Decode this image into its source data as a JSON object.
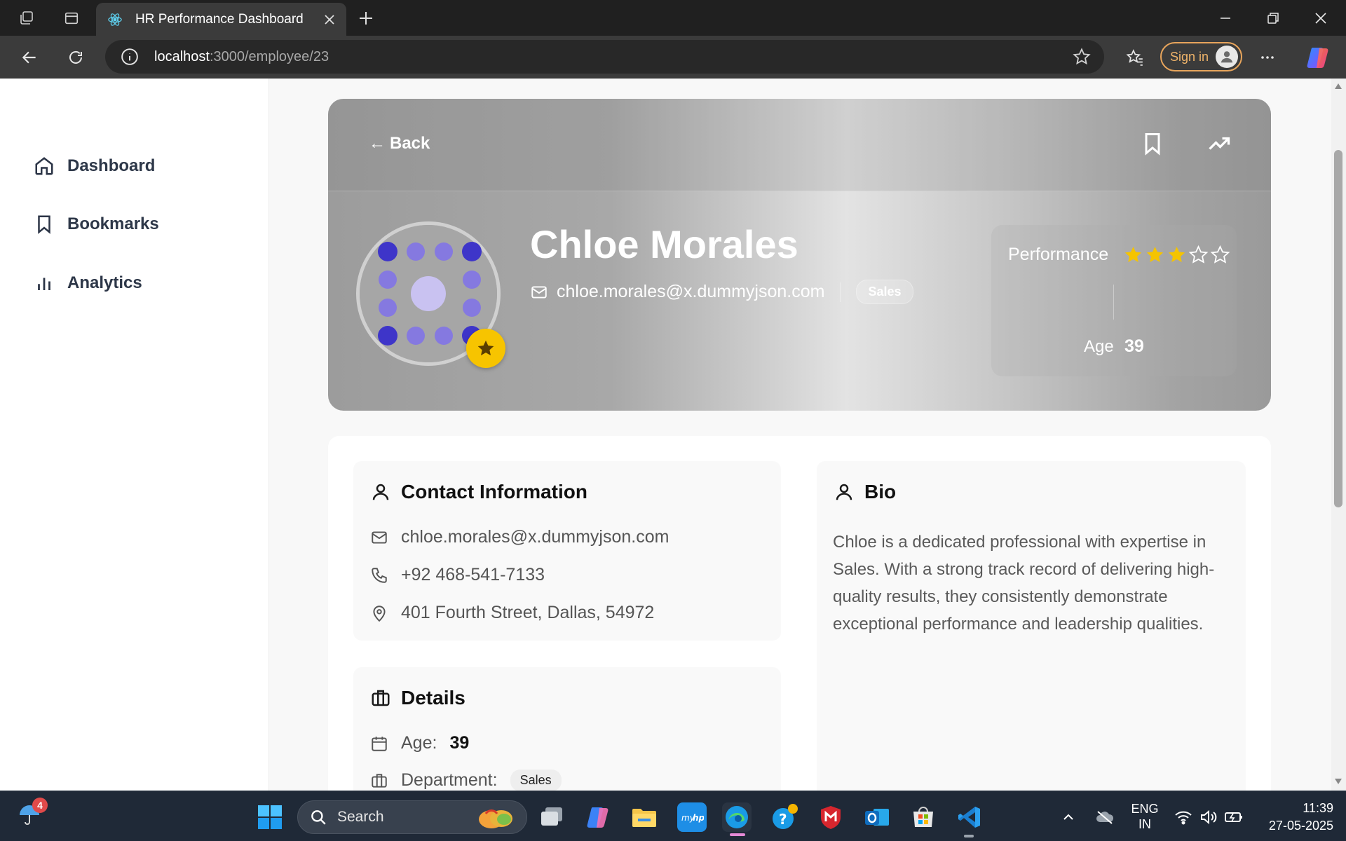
{
  "browser": {
    "tab_title": "HR Performance Dashboard",
    "url_host": "localhost",
    "url_path": ":3000/employee/23",
    "sign_in_label": "Sign in"
  },
  "sidebar": {
    "items": [
      {
        "label": "Dashboard",
        "icon": "home-icon"
      },
      {
        "label": "Bookmarks",
        "icon": "bookmark-icon"
      },
      {
        "label": "Analytics",
        "icon": "bar-chart-icon"
      }
    ]
  },
  "hero": {
    "back_label": "Back",
    "back_arrow": "←",
    "name": "Chloe Morales",
    "email": "chloe.morales@x.dummyjson.com",
    "department": "Sales",
    "performance_label": "Performance",
    "rating": 3,
    "rating_max": 5,
    "age_label": "Age",
    "age_value": "39"
  },
  "contact": {
    "title": "Contact Information",
    "email": "chloe.morales@x.dummyjson.com",
    "phone": "+92 468-541-7133",
    "address": "401 Fourth Street, Dallas, 54972"
  },
  "bio": {
    "title": "Bio",
    "text": "Chloe is a dedicated professional with expertise in Sales. With a strong track record of delivering high-quality results, they consistently demonstrate exceptional performance and leadership qualities."
  },
  "details": {
    "title": "Details",
    "age_label": "Age:",
    "age_value": "39",
    "department_label": "Department:",
    "department_value": "Sales"
  },
  "taskbar": {
    "search_label": "Search",
    "weather_badge": "4",
    "lang_line1": "ENG",
    "lang_line2": "IN",
    "time": "11:39",
    "date": "27-05-2025"
  },
  "colors": {
    "star_filled": "#f5c400",
    "accent_orange": "#e8a55c",
    "taskbar_bg": "#1f2937"
  }
}
